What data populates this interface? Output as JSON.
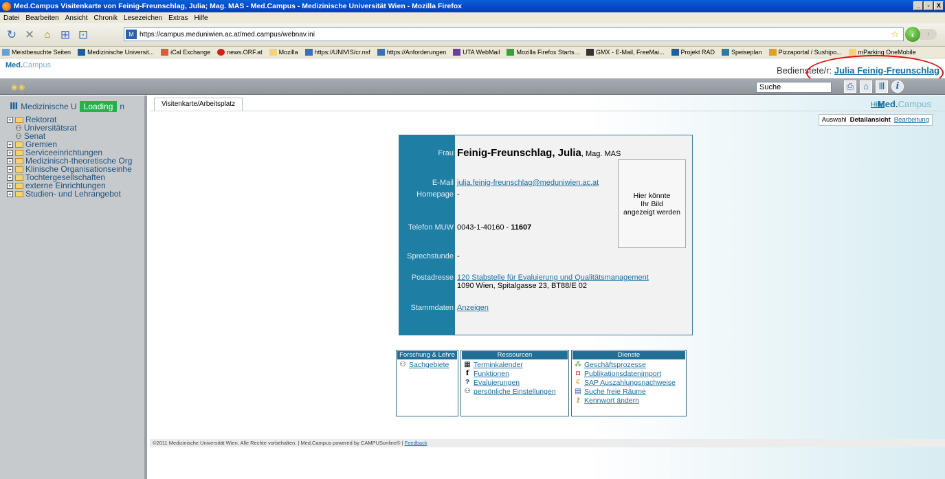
{
  "window": {
    "title": "Med.Campus Visitenkarte von Feinig-Freunschlag, Julia; Mag. MAS - Med.Campus - Medizinische Universität Wien - Mozilla Firefox",
    "min": "_",
    "max": "▫",
    "close": "X"
  },
  "menu": [
    "Datei",
    "Bearbeiten",
    "Ansicht",
    "Chronik",
    "Lesezeichen",
    "Extras",
    "Hilfe"
  ],
  "nav": {
    "url": "https://campus.meduniwien.ac.at/med.campus/webnav.ini"
  },
  "bookmarks": [
    "Meistbesuchte Seiten",
    "Medizinische Universit...",
    "iCal Exchange",
    "news.ORF.at",
    "Mozilla",
    "https://UNIVIS/cr.nsf",
    "https://Anforderungen",
    "UTA WebMail",
    "Mozilla Firefox Starts...",
    "GMX - E-Mail, FreeMai...",
    "Projekt RAD",
    "Speiseplan",
    "Pizzaportal / Sushipo...",
    "mParking OneMobile"
  ],
  "header": {
    "logo_bold": "Med.",
    "logo_light": "Campus",
    "user_label": "Bedienstete/r:",
    "user_name": "Julia Feinig-Freunschlag"
  },
  "toolbar": {
    "search_value": "Suche"
  },
  "sidebar": {
    "root": "Medizinische U",
    "loading": "Loading",
    "root_tail": "n",
    "items": [
      {
        "label": "Rektorat",
        "type": "folder"
      },
      {
        "label": "Universitätsrat",
        "type": "people"
      },
      {
        "label": "Senat",
        "type": "people"
      },
      {
        "label": "Gremien",
        "type": "folder"
      },
      {
        "label": "Serviceeinrichtungen",
        "type": "folder"
      },
      {
        "label": "Medizinisch-theoretische Org",
        "type": "folder"
      },
      {
        "label": "Klinische Organisationseinhe",
        "type": "folder"
      },
      {
        "label": "Tochtergesellschaften",
        "type": "folder"
      },
      {
        "label": "externe Einrichtungen",
        "type": "folder"
      },
      {
        "label": "Studien- und Lehrangebot",
        "type": "folder"
      }
    ]
  },
  "main": {
    "tab_label": "Visitenkarte/Arbeitsplatz",
    "hilfe": "Hilfe",
    "brand_bold": "Med.",
    "brand_light": "Campus",
    "view_tabs": {
      "auswahl": "Auswahl",
      "detail": "Detailansicht",
      "edit": "Bearbeitung"
    }
  },
  "card": {
    "salutation": "Frau",
    "name": "Feinig-Freunschlag, Julia",
    "degree": ", Mag. MAS",
    "email_label": "E-Mail",
    "email": "julia.feinig-freunschlag@meduniwien.ac.at",
    "homepage_label": "Homepage",
    "homepage": "-",
    "phone_label": "Telefon  MUW",
    "phone": "0043-1-40160 - ",
    "phone_ext": "11607",
    "office_hours_label": "Sprechstunde",
    "office_hours": "-",
    "address_label": "Postadresse",
    "address_link": "120 Stabstelle für Evaluierung und Qualitätsmanagement",
    "address_line2": "1090 Wien, Spitalgasse 23, BT88/E 02",
    "master_label": "Stammdaten",
    "master_link": "Anzeigen",
    "photo_text_1": "Hier könnte",
    "photo_text_2": "Ihr Bild",
    "photo_text_3": "angezeigt werden"
  },
  "services": {
    "research": {
      "header": "Forschung & Lehre",
      "items": [
        "Sachgebiete"
      ]
    },
    "resources": {
      "header": "Ressourcen",
      "items": [
        "Terminkalender",
        "Funktionen",
        "Evaluierungen",
        "persönliche Einstellungen"
      ]
    },
    "dienste": {
      "header": "Dienste",
      "items": [
        "Geschäftsprozesse",
        "Publikationsdatenimport",
        "SAP Auszahlungsnachweise",
        "Suche freie Räume",
        "Kennwort ändern"
      ]
    }
  },
  "footer": {
    "text": "©2011 Medizinische Universität Wien. Alle Rechte vorbehalten. | Med.Campus powered by CAMPUSonline® | ",
    "feedback": "Feedback"
  }
}
